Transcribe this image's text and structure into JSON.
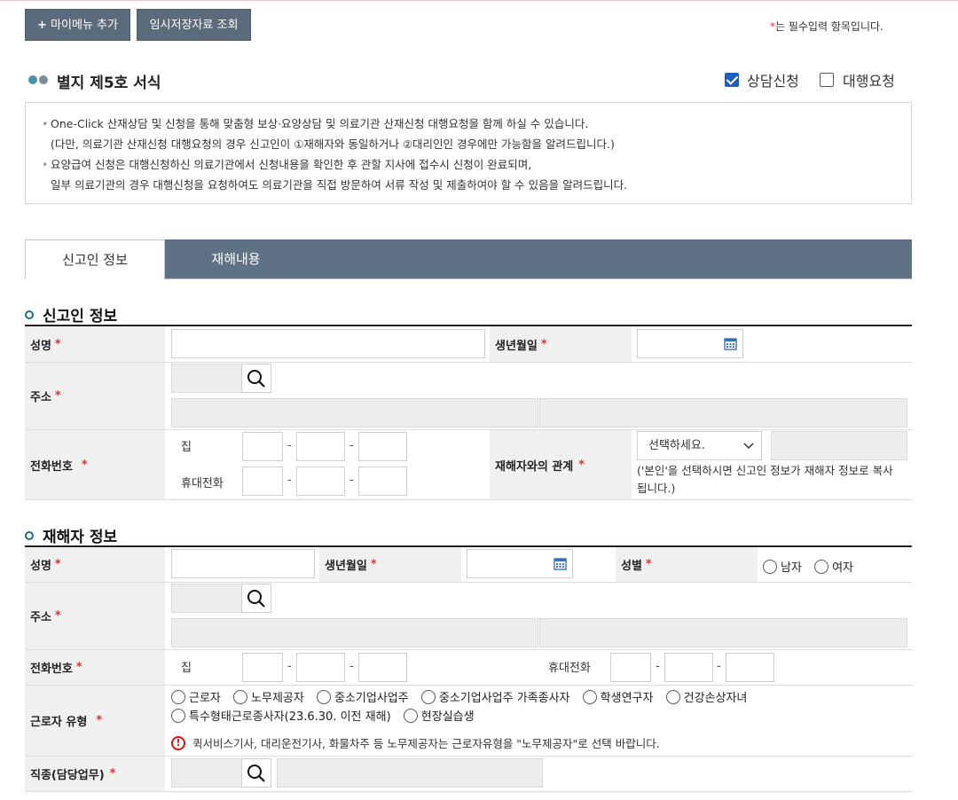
{
  "toolbar": {
    "add_menu_label": "마이메뉴 추가",
    "temp_saved_label": "임시저장자료 조회"
  },
  "required_note": {
    "star": "*",
    "text": "는 필수입력 항목입니다."
  },
  "form_title": "별지 제5호 서식",
  "request_options": {
    "consult": "상담신청",
    "consult_checked": true,
    "agency": "대행요청",
    "agency_checked": false
  },
  "notice": {
    "line1": "One-Click 산재상담 및 신청을 통해 맞춤형 보상·요양상담 및 의료기관 산재신청 대행요청을 함께 하실 수 있습니다.",
    "line2": "(다만, 의료기관 산재신청 대행요청의 경우 신고인이 ①재해자와 동일하거나 ②대리인인 경우에만 가능함을 알려드립니다.)",
    "line3": "요양급여 신청은 대행신청하신 의료기관에서 신청내용을 확인한 후 관할 지사에 접수시 신청이 완료되며,",
    "line4": "일부 의료기관의 경우 대행신청을 요청하여도 의료기관을 직접 방문하여 서류 작성 및 제출하여야 할 수 있음을 알려드립니다."
  },
  "tabs": [
    {
      "label": "신고인 정보",
      "active": true
    },
    {
      "label": "재해내용",
      "active": false
    }
  ],
  "reporter": {
    "section_title": "신고인 정보",
    "name_label": "성명",
    "birth_label": "생년월일",
    "address_label": "주소",
    "phone_label": "전화번호",
    "home_label": "집",
    "mobile_label": "휴대전화",
    "relation_label": "재해자와의 관계",
    "relation_value": "선택하세요.",
    "relation_note": "('본인'을 선택하시면 신고인 정보가 재해자 정보로 복사됩니다.)",
    "dash": "-"
  },
  "victim": {
    "section_title": "재해자 정보",
    "name_label": "성명",
    "birth_label": "생년월일",
    "gender_label": "성별",
    "male": "남자",
    "female": "여자",
    "address_label": "주소",
    "phone_label": "전화번호",
    "home_label": "집",
    "mobile_label": "휴대전화",
    "worker_type_label": "근로자 유형",
    "worker_types": [
      "근로자",
      "노무제공자",
      "중소기업사업주",
      "중소기업사업주 가족종사자",
      "학생연구자",
      "건강손상자녀",
      "특수형태근로종사자(23.6.30. 이전 재해)",
      "현장실습생"
    ],
    "worker_warning": "퀵서비스기사, 대리운전기사, 화물차주 등 노무제공자는 근로자유형을 \"노무제공자\"로 선택 바랍니다.",
    "job_label": "직종(담당업무)",
    "dash": "-"
  },
  "colors": {
    "button_bg": "#5b6b7c",
    "tab_bar": "#5f7184",
    "required": "#dd3333",
    "section_ring": "#1c6e86",
    "checkbox_on": "#1f5fbf"
  },
  "icons": [
    "plus-icon",
    "search-icon",
    "calendar-icon",
    "chevron-down-icon",
    "warning-icon"
  ]
}
